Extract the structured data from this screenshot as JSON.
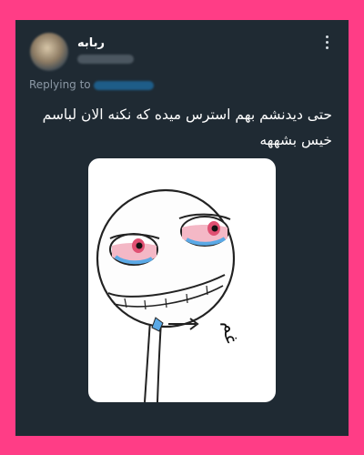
{
  "tweet": {
    "display_name": "ربابه",
    "replying_label": "Replying to",
    "text": "حتی دیدنشم بهم استرس میده که نکنه الان لباسم خیس بشههه",
    "image_caption": "غم"
  },
  "colors": {
    "frame_bg": "#ff3d86",
    "card_bg": "#1f2a33",
    "text_primary": "#ffffff",
    "text_secondary": "#8b98a5",
    "accent": "#1d9bf0"
  },
  "icons": {
    "more": "more-options-icon"
  }
}
